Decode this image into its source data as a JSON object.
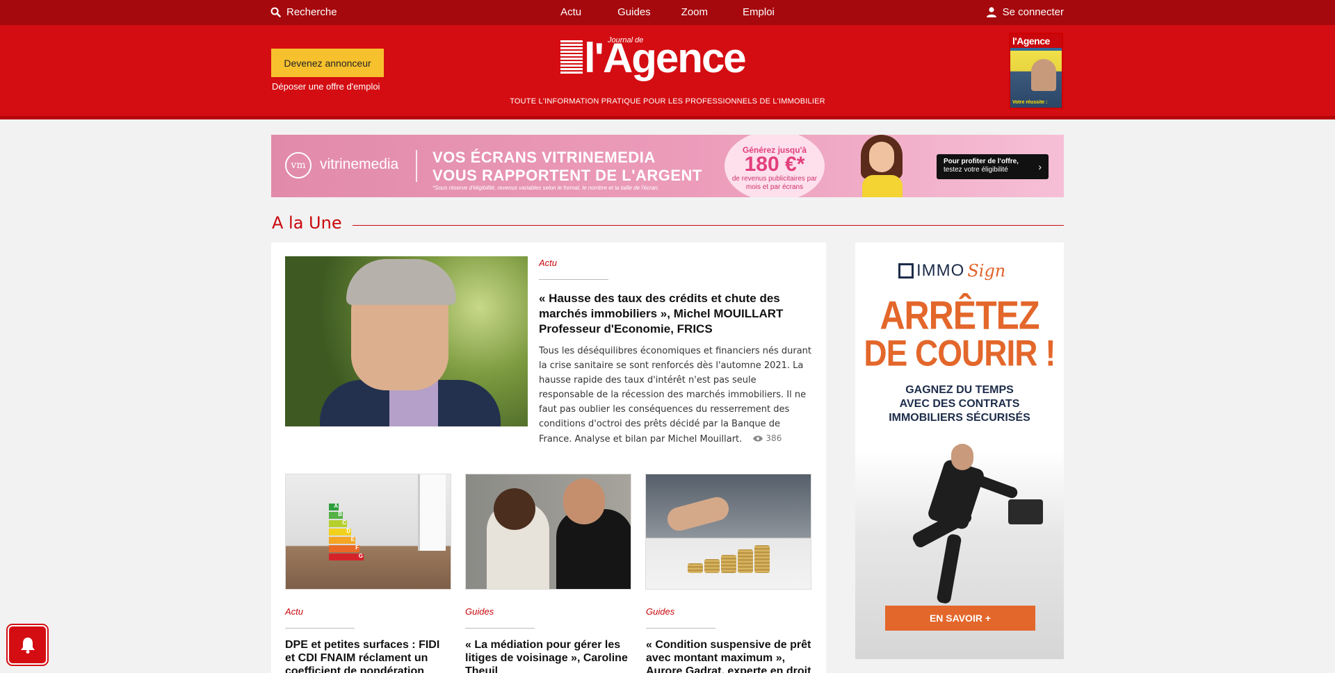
{
  "topbar": {
    "search_label": "Recherche",
    "nav": [
      "Actu",
      "Guides",
      "Zoom",
      "Emploi"
    ],
    "login_label": "Se connecter",
    "icons": {
      "search": "search-icon",
      "user": "user-icon"
    }
  },
  "header": {
    "cta_button": "Devenez annonceur",
    "cta_link": "Déposer une offre d'emploi",
    "logo_prefix": "Journal de",
    "logo_name": "l'Agence",
    "tagline": "TOUTE L'INFORMATION PRATIQUE POUR LES PROFESSIONNELS DE L'IMMOBILIER",
    "magazine": {
      "title": "l'Agence",
      "caption": "Votre réussite :"
    }
  },
  "ad_banner": {
    "brand": "vitrinemedia",
    "brand_mark": "vm",
    "headline_1": "VOS ÉCRANS VITRINEMEDIA",
    "headline_2": "VOUS RAPPORTENT DE L'ARGENT",
    "note": "*Sous réserve d'éligibilité, revenus variables selon le format, le nombre et la taille de l'écran.",
    "bubble_line1": "Générez jusqu'à",
    "bubble_amount": "180 €*",
    "bubble_line3": "de revenus publicitaires par mois et par écrans",
    "cta_line1": "Pour profiter de l'offre,",
    "cta_line2": "testez votre éligibilité"
  },
  "section": {
    "title": "A la Une"
  },
  "featured": {
    "category": "Actu",
    "title": "« Hausse des taux des crédits et chute des marchés immobiliers », Michel MOUILLART Professeur d'Economie, FRICS",
    "excerpt": "Tous les déséquilibres économiques et financiers nés durant la crise sanitaire se sont renforcés dès l'automne 2021. La hausse rapide des taux d'intérêt n'est pas seule responsable de la récession des marchés immobiliers. Il ne faut pas oublier les conséquences du resserrement des conditions d'octroi des prêts décidé par la Banque de France. Analyse et bilan par Michel Mouillart.",
    "views": "386"
  },
  "cards": [
    {
      "category": "Actu",
      "title": "DPE et petites surfaces : FIDI et CDI FNAIM réclament un coefficient de pondération"
    },
    {
      "category": "Guides",
      "title": "« La médiation pour gérer les litiges de voisinage », Caroline Theuil"
    },
    {
      "category": "Guides",
      "title": "« Condition suspensive de prêt avec montant maximum », Aurore Gadrat, experte en droit"
    }
  ],
  "energy_labels": [
    "A",
    "B",
    "C",
    "D",
    "E",
    "F",
    "G"
  ],
  "side_ad": {
    "logo_immo": "IMMO",
    "logo_sign": "Sign",
    "headline_1": "ARRÊTEZ",
    "headline_2": "DE COURIR !",
    "sub_1": "GAGNEZ DU TEMPS",
    "sub_2": "AVEC DES CONTRATS",
    "sub_3": "IMMOBILIERS SÉCURISÉS",
    "button": "EN SAVOIR +"
  },
  "colors": {
    "brand_red": "#d40d12",
    "topbar_red": "#a5080d",
    "cta_yellow": "#f7c12e",
    "accent_orange": "#e3672b",
    "navy": "#1d2c4a"
  }
}
